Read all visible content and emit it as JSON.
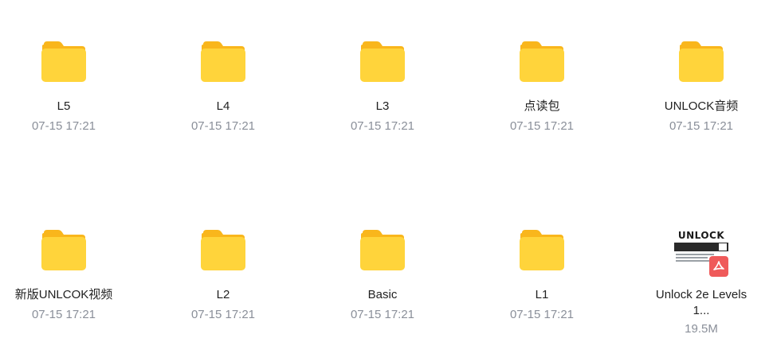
{
  "items": [
    {
      "name": "L5",
      "time": "07-15 17:21"
    },
    {
      "name": "L4",
      "time": "07-15 17:21"
    },
    {
      "name": "L3",
      "time": "07-15 17:21"
    },
    {
      "name": "点读包",
      "time": "07-15 17:21"
    },
    {
      "name": "UNLOCK音频",
      "time": "07-15 17:21"
    },
    {
      "name": "新版UNLCOK视频",
      "time": "07-15 17:21"
    },
    {
      "name": "L2",
      "time": "07-15 17:21"
    },
    {
      "name": "Basic",
      "time": "07-15 17:21"
    },
    {
      "name": "L1",
      "time": "07-15 17:21"
    }
  ],
  "pdf": {
    "name_line1": "Unlock 2e Levels",
    "name_line2": "1...",
    "size": "19.5M",
    "thumb_logo": "UNLOCK",
    "icon": "pdf-file-icon"
  },
  "colors": {
    "folder_body": "#FFD43B",
    "folder_tab": "#F9B61C",
    "pdf_badge": "#EF5A5A"
  }
}
